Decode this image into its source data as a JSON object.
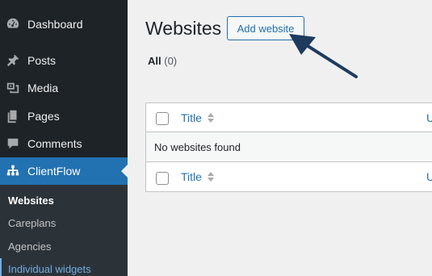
{
  "sidebar": {
    "items": [
      {
        "label": "Dashboard",
        "icon": "dashboard-icon"
      },
      {
        "label": "Posts",
        "icon": "pin-icon"
      },
      {
        "label": "Media",
        "icon": "media-icon"
      },
      {
        "label": "Pages",
        "icon": "pages-icon"
      },
      {
        "label": "Comments",
        "icon": "comment-icon"
      },
      {
        "label": "ClientFlow",
        "icon": "sitemap-icon",
        "active": true
      }
    ],
    "submenu": [
      "Websites",
      "Careplans",
      "Agencies",
      "Individual widgets"
    ]
  },
  "main": {
    "title": "Websites",
    "add_button": "Add website",
    "filter_all": "All",
    "filter_count": "(0)"
  },
  "table": {
    "col_title": "Title",
    "col_next": "U",
    "empty_message": "No websites found"
  },
  "colors": {
    "sidebar_bg": "#1d2327",
    "accent": "#2271b1",
    "arrow": "#1e3a5f"
  }
}
